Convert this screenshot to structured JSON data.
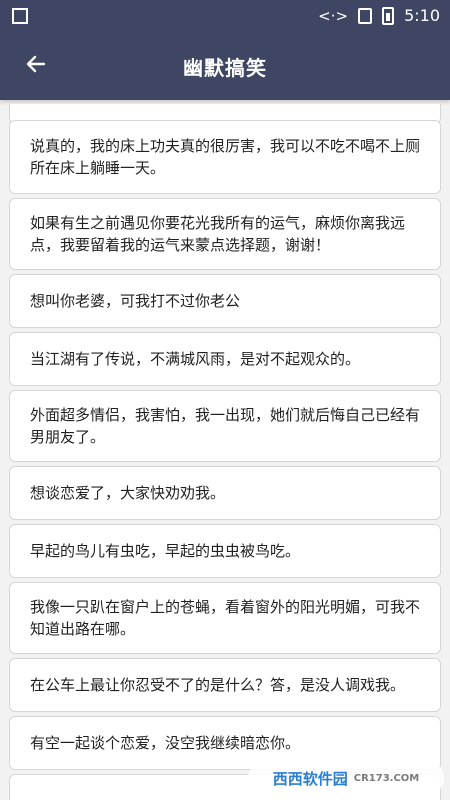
{
  "status_bar": {
    "time": "5:10",
    "left_icon": "image-icon",
    "network_icon": "code-bracket-icon",
    "signal_icon": "no-sim-icon",
    "battery_icon": "battery-charging-icon"
  },
  "app_bar": {
    "title": "幽默搞笑",
    "back_icon": "arrow-left-icon",
    "background": "#3e4663"
  },
  "jokes": [
    "说真的，我的床上功夫真的很厉害，我可以不吃不喝不上厕所在床上躺睡一天。",
    "如果有生之前遇见你要花光我所有的运气，麻烦你离我远点，我要留着我的运气来蒙点选择题，谢谢！",
    "想叫你老婆，可我打不过你老公",
    "当江湖有了传说，不满城风雨，是对不起观众的。",
    "外面超多情侣，我害怕，我一出现，她们就后悔自己已经有男朋友了。",
    "想谈恋爱了，大家快劝劝我。",
    "早起的鸟儿有虫吃，早起的虫虫被鸟吃。",
    "我像一只趴在窗户上的苍蝇，看着窗外的阳光明媚，可我不知道出路在哪。",
    "在公车上最让你忍受不了的是什么？答，是没人调戏我。",
    "有空一起谈个恋爱，没空我继续暗恋你。"
  ],
  "watermark": {
    "text": "西西软件园",
    "sub": "CR173.COM"
  }
}
